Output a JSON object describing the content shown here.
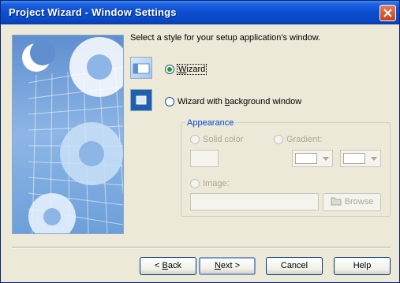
{
  "window": {
    "title": "Project Wizard - Window Settings"
  },
  "prompt": "Select a style for your setup application's window.",
  "styles": {
    "wizard": {
      "label_pre": "",
      "label_accel": "W",
      "label_post": "izard",
      "selected": true
    },
    "wizard_bg": {
      "label_pre": "Wizard with ",
      "label_accel": "b",
      "label_post": "ackground window",
      "selected": false
    }
  },
  "appearance": {
    "title": "Appearance",
    "solid_color_label": "Solid color",
    "gradient_label": "Gradient:",
    "image_label": "Image:",
    "image_path": "",
    "browse_label": "Browse"
  },
  "buttons": {
    "back_accel": "B",
    "back_post": "ack",
    "next_accel": "N",
    "next_post": "ext",
    "cancel": "Cancel",
    "help": "Help"
  },
  "colors": {
    "title_bar": "#0a4ecf",
    "accent_group_title": "#0046d5",
    "radio_dot": "#21a121"
  }
}
